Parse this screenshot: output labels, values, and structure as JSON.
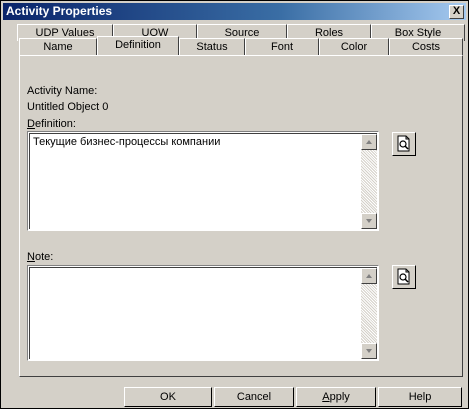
{
  "window": {
    "title": "Activity Properties",
    "close_label": "X"
  },
  "tabs_back": [
    "UDP Values",
    "UOW",
    "Source",
    "Roles",
    "Box Style"
  ],
  "tabs_front": [
    "Name",
    "Definition",
    "Status",
    "Font",
    "Color",
    "Costs"
  ],
  "active_tab": "Definition",
  "activity": {
    "name_label": "Activity Name:",
    "name_value": "Untitled Object 0"
  },
  "definition": {
    "label": "Definition:",
    "value": "Текущие бизнес-процессы компании"
  },
  "note": {
    "label": "Note:",
    "value": ""
  },
  "buttons": {
    "ok": "OK",
    "cancel": "Cancel",
    "apply": "Apply",
    "help": "Help"
  },
  "colors": {
    "titlebar_start": "#0a246a",
    "titlebar_end": "#a6caf0",
    "dialog_bg": "#d4d0c8"
  }
}
